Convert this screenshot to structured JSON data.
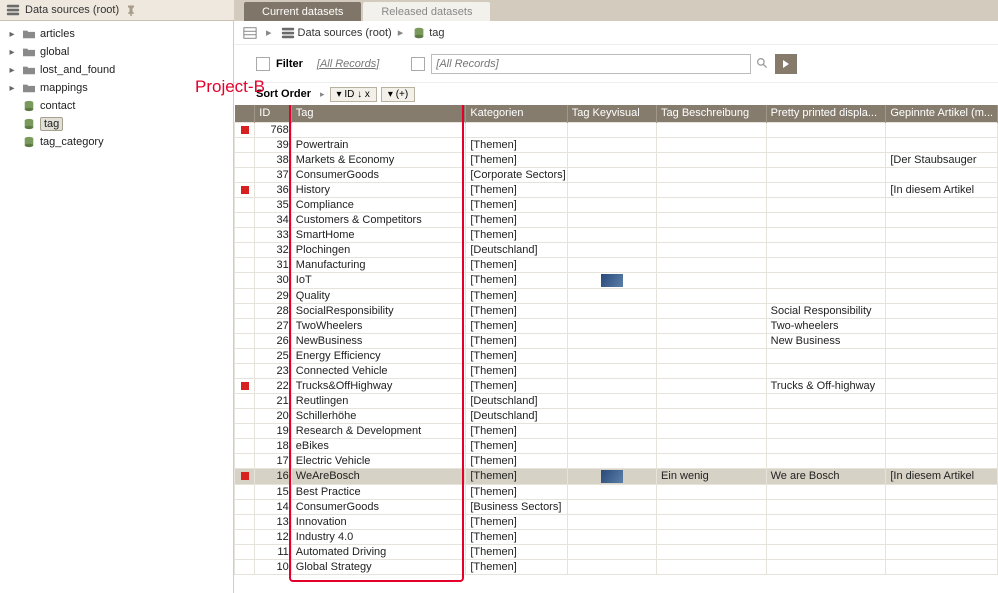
{
  "header": {
    "sidebar_title": "Data sources (root)"
  },
  "tabs": [
    {
      "label": "Current datasets",
      "active": true
    },
    {
      "label": "Released datasets",
      "active": false
    }
  ],
  "tree": [
    {
      "label": "articles",
      "type": "folder",
      "expand": "▸"
    },
    {
      "label": "global",
      "type": "folder",
      "expand": "▸"
    },
    {
      "label": "lost_and_found",
      "type": "folder",
      "expand": "▸"
    },
    {
      "label": "mappings",
      "type": "folder",
      "expand": "▸"
    },
    {
      "label": "contact",
      "type": "db",
      "expand": ""
    },
    {
      "label": "tag",
      "type": "db",
      "expand": "",
      "selected": true
    },
    {
      "label": "tag_category",
      "type": "db",
      "expand": ""
    }
  ],
  "breadcrumb": {
    "root": "Data sources (root)",
    "leaf": "tag"
  },
  "filter": {
    "label": "Filter",
    "all_records": "[All Records]",
    "search_placeholder": "[All Records]"
  },
  "sort": {
    "label": "Sort Order",
    "btn1": "▾ ID  ↓  x",
    "btn2": "▾ (+)"
  },
  "columns": {
    "c0": "",
    "c1": "ID",
    "c2": "Tag",
    "c3": "Kategorien",
    "c4": "Tag Keyvisual",
    "c5": "Tag Beschreibung",
    "c6": "Pretty printed displa...",
    "c7": "Gepinnte Artikel (m..."
  },
  "rows": [
    {
      "mark": true,
      "id": "768",
      "tag": "",
      "kat": "",
      "kv": "",
      "desc": "",
      "disp": "",
      "pin": "",
      "sel": false
    },
    {
      "mark": false,
      "id": "39",
      "tag": "Powertrain",
      "kat": "[Themen]",
      "kv": "",
      "desc": "",
      "disp": "",
      "pin": "",
      "sel": false
    },
    {
      "mark": false,
      "id": "38",
      "tag": "Markets & Economy",
      "kat": "[Themen]",
      "kv": "",
      "desc": "",
      "disp": "",
      "pin": "[Der Staubsauger",
      "sel": false
    },
    {
      "mark": false,
      "id": "37",
      "tag": "ConsumerGoods",
      "kat": "[Corporate Sectors]",
      "kv": "",
      "desc": "",
      "disp": "",
      "pin": "",
      "sel": false
    },
    {
      "mark": true,
      "id": "36",
      "tag": "History",
      "kat": "[Themen]",
      "kv": "",
      "desc": "",
      "disp": "",
      "pin": "[In diesem Artikel",
      "sel": false
    },
    {
      "mark": false,
      "id": "35",
      "tag": "Compliance",
      "kat": "[Themen]",
      "kv": "",
      "desc": "",
      "disp": "",
      "pin": "",
      "sel": false
    },
    {
      "mark": false,
      "id": "34",
      "tag": "Customers & Competitors",
      "kat": "[Themen]",
      "kv": "",
      "desc": "",
      "disp": "",
      "pin": "",
      "sel": false
    },
    {
      "mark": false,
      "id": "33",
      "tag": "SmartHome",
      "kat": "[Themen]",
      "kv": "",
      "desc": "",
      "disp": "",
      "pin": "",
      "sel": false
    },
    {
      "mark": false,
      "id": "32",
      "tag": "Plochingen",
      "kat": "[Deutschland]",
      "kv": "",
      "desc": "",
      "disp": "",
      "pin": "",
      "sel": false
    },
    {
      "mark": false,
      "id": "31",
      "tag": "Manufacturing",
      "kat": "[Themen]",
      "kv": "",
      "desc": "",
      "disp": "",
      "pin": "",
      "sel": false
    },
    {
      "mark": false,
      "id": "30",
      "tag": "IoT",
      "kat": "[Themen]",
      "kv": "img",
      "desc": "",
      "disp": "",
      "pin": "",
      "sel": false
    },
    {
      "mark": false,
      "id": "29",
      "tag": "Quality",
      "kat": "[Themen]",
      "kv": "",
      "desc": "",
      "disp": "",
      "pin": "",
      "sel": false
    },
    {
      "mark": false,
      "id": "28",
      "tag": "SocialResponsibility",
      "kat": "[Themen]",
      "kv": "",
      "desc": "",
      "disp": "Social Responsibility",
      "pin": "",
      "sel": false
    },
    {
      "mark": false,
      "id": "27",
      "tag": "TwoWheelers",
      "kat": "[Themen]",
      "kv": "",
      "desc": "",
      "disp": "Two-wheelers",
      "pin": "",
      "sel": false
    },
    {
      "mark": false,
      "id": "26",
      "tag": "NewBusiness",
      "kat": "[Themen]",
      "kv": "",
      "desc": "",
      "disp": "New Business",
      "pin": "",
      "sel": false
    },
    {
      "mark": false,
      "id": "25",
      "tag": "Energy Efficiency",
      "kat": "[Themen]",
      "kv": "",
      "desc": "",
      "disp": "",
      "pin": "",
      "sel": false
    },
    {
      "mark": false,
      "id": "23",
      "tag": "Connected Vehicle",
      "kat": "[Themen]",
      "kv": "",
      "desc": "",
      "disp": "",
      "pin": "",
      "sel": false
    },
    {
      "mark": true,
      "id": "22",
      "tag": "Trucks&OffHighway",
      "kat": "[Themen]",
      "kv": "",
      "desc": "",
      "disp": "Trucks & Off-highway",
      "pin": "",
      "sel": false
    },
    {
      "mark": false,
      "id": "21",
      "tag": "Reutlingen",
      "kat": "[Deutschland]",
      "kv": "",
      "desc": "",
      "disp": "",
      "pin": "",
      "sel": false
    },
    {
      "mark": false,
      "id": "20",
      "tag": "Schillerhöhe",
      "kat": "[Deutschland]",
      "kv": "",
      "desc": "",
      "disp": "",
      "pin": "",
      "sel": false
    },
    {
      "mark": false,
      "id": "19",
      "tag": "Research & Development",
      "kat": "[Themen]",
      "kv": "",
      "desc": "",
      "disp": "",
      "pin": "",
      "sel": false
    },
    {
      "mark": false,
      "id": "18",
      "tag": "eBikes",
      "kat": "[Themen]",
      "kv": "",
      "desc": "",
      "disp": "",
      "pin": "",
      "sel": false
    },
    {
      "mark": false,
      "id": "17",
      "tag": "Electric Vehicle",
      "kat": "[Themen]",
      "kv": "",
      "desc": "",
      "disp": "",
      "pin": "",
      "sel": false
    },
    {
      "mark": true,
      "id": "16",
      "tag": "WeAreBosch",
      "kat": "[Themen]",
      "kv": "img",
      "desc": "Ein wenig",
      "disp": "We are Bosch",
      "pin": "[In diesem Artikel",
      "sel": true
    },
    {
      "mark": false,
      "id": "15",
      "tag": "Best Practice",
      "kat": "[Themen]",
      "kv": "",
      "desc": "",
      "disp": "",
      "pin": "",
      "sel": false
    },
    {
      "mark": false,
      "id": "14",
      "tag": "ConsumerGoods",
      "kat": "[Business Sectors]",
      "kv": "",
      "desc": "",
      "disp": "",
      "pin": "",
      "sel": false
    },
    {
      "mark": false,
      "id": "13",
      "tag": "Innovation",
      "kat": "[Themen]",
      "kv": "",
      "desc": "",
      "disp": "",
      "pin": "",
      "sel": false
    },
    {
      "mark": false,
      "id": "12",
      "tag": "Industry 4.0",
      "kat": "[Themen]",
      "kv": "",
      "desc": "",
      "disp": "",
      "pin": "",
      "sel": false
    },
    {
      "mark": false,
      "id": "11",
      "tag": "Automated Driving",
      "kat": "[Themen]",
      "kv": "",
      "desc": "",
      "disp": "",
      "pin": "",
      "sel": false
    },
    {
      "mark": false,
      "id": "10",
      "tag": "Global Strategy",
      "kat": "[Themen]",
      "kv": "",
      "desc": "",
      "disp": "",
      "pin": "",
      "sel": false
    }
  ],
  "annotation": {
    "label": "Project-B"
  }
}
